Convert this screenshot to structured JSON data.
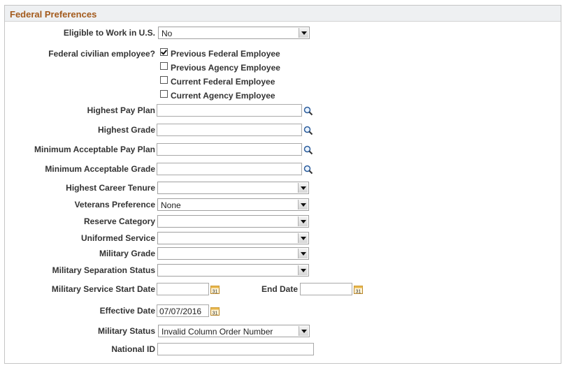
{
  "section": {
    "title": "Federal Preferences"
  },
  "fields": {
    "eligible": {
      "label": "Eligible to Work in U.S.",
      "value": "No"
    },
    "civilian": {
      "label": "Federal civilian employee?",
      "options": [
        {
          "label": "Previous Federal Employee",
          "checked": true
        },
        {
          "label": "Previous Agency Employee",
          "checked": false
        },
        {
          "label": "Current Federal Employee",
          "checked": false
        },
        {
          "label": "Current Agency Employee",
          "checked": false
        }
      ]
    },
    "highest_pay_plan": {
      "label": "Highest Pay Plan",
      "value": ""
    },
    "highest_grade": {
      "label": "Highest Grade",
      "value": ""
    },
    "min_pay_plan": {
      "label": "Minimum Acceptable Pay Plan",
      "value": ""
    },
    "min_grade": {
      "label": "Minimum Acceptable Grade",
      "value": ""
    },
    "career_tenure": {
      "label": "Highest Career Tenure",
      "value": ""
    },
    "veterans_pref": {
      "label": "Veterans Preference",
      "value": "None"
    },
    "reserve_category": {
      "label": "Reserve Category",
      "value": ""
    },
    "uniformed_service": {
      "label": "Uniformed Service",
      "value": ""
    },
    "military_grade": {
      "label": "Military Grade",
      "value": ""
    },
    "mil_sep_status": {
      "label": "Military Separation Status",
      "value": ""
    },
    "mil_start_date": {
      "label": "Military Service Start Date",
      "value": ""
    },
    "end_date": {
      "label": "End Date",
      "value": ""
    },
    "effective_date": {
      "label": "Effective Date",
      "value": "07/07/2016"
    },
    "military_status": {
      "label": "Military Status",
      "value": "Invalid Column Order Number"
    },
    "national_id": {
      "label": "National ID",
      "value": ""
    }
  },
  "icons": {
    "lookup": "magnifier-icon",
    "calendar": "calendar-icon"
  },
  "colors": {
    "title": "#a35a1c",
    "header_bg": "#eef0f2",
    "calendar": "#e8b64a"
  }
}
